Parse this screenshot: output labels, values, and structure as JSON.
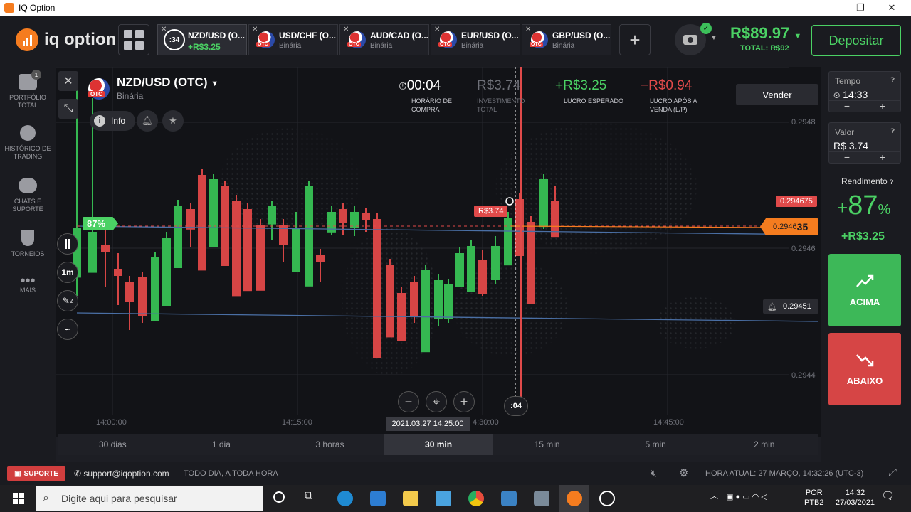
{
  "window": {
    "title": "IQ Option",
    "minimize": "—",
    "maximize": "❐",
    "close": "✕"
  },
  "logo": {
    "text": "iq option"
  },
  "tabs": [
    {
      "name": "NZD/USD (O...",
      "sub": "+R$3.25",
      "timer": ":34"
    },
    {
      "name": "USD/CHF (O...",
      "sub": "Binária"
    },
    {
      "name": "AUD/CAD (O...",
      "sub": "Binária"
    },
    {
      "name": "EUR/USD (O...",
      "sub": "Binária"
    },
    {
      "name": "GBP/USD (O...",
      "sub": "Binária"
    }
  ],
  "otc": "OTC",
  "balance": {
    "amount": "R$89.97",
    "total": "TOTAL: R$92"
  },
  "deposit": "Depositar",
  "sidebar": [
    {
      "label1": "PORTFÓLIO",
      "label2": "TOTAL",
      "badge": "1"
    },
    {
      "label1": "HISTÓRICO DE",
      "label2": "TRADING"
    },
    {
      "label1": "CHATS E",
      "label2": "SUPORTE"
    },
    {
      "label1": "TORNEIOS",
      "label2": ""
    },
    {
      "label1": "MAIS",
      "label2": ""
    }
  ],
  "asset": {
    "title": "NZD/USD (OTC)",
    "type": "Binária",
    "info": "Info"
  },
  "stats": {
    "timer": "00:04",
    "timer_label1": "HORÁRIO DE",
    "timer_label2": "COMPRA",
    "invest": "R$3.74",
    "invest_label1": "INVESTIMENTO",
    "invest_label2": "TOTAL",
    "profit": "+R$3.25",
    "profit_label": "LUCRO ESPERADO",
    "after": "−R$0.94",
    "after_label1": "LUCRO APÓS A",
    "after_label2": "VENDA (L/P)"
  },
  "sell": "Vender",
  "chart_labels": {
    "y": [
      "0.2948",
      "0.2946",
      "0.2944"
    ],
    "x": [
      "14:00:00",
      "14:15:00",
      "4:30:00",
      "14:45:00"
    ],
    "price_red": "0.294675",
    "price_current_a": "0.2946",
    "price_current_b": "35",
    "price_alert": "0.29451",
    "pct": "87%",
    "deal": "R$3.74",
    "cursor_time": "2021.03.27 14:25:00",
    "countdown": ":04",
    "timeframe": "1m",
    "tool_badge": "2"
  },
  "periods": [
    "30 dias",
    "1 dia",
    "3 horas",
    "30 min",
    "15 min",
    "5 min",
    "2 min"
  ],
  "right": {
    "time_label": "Tempo",
    "time_value": "14:33",
    "value_label": "Valor",
    "value_value": "R$ 3.74",
    "yield_label": "Rendimento",
    "yield_sign": "+",
    "yield_pct": "87",
    "yield_pct_unit": "%",
    "yield_amount": "+R$3.25",
    "up": "ACIMA",
    "down": "ABAIXO"
  },
  "status": {
    "support": "SUPORTE",
    "email": "support@iqoption.com",
    "hours": "TODO DIA, A TODA HORA",
    "clock": "HORA ATUAL: 27 MARÇO, 14:32:26 (UTC-3)"
  },
  "taskbar": {
    "search": "Digite aqui para pesquisar",
    "lang1": "POR",
    "lang2": "PTB2",
    "time": "14:32",
    "date": "27/03/2021"
  },
  "colors": {
    "green": "#4bd164",
    "red": "#e04a4a",
    "accent": "#f57c1f"
  }
}
